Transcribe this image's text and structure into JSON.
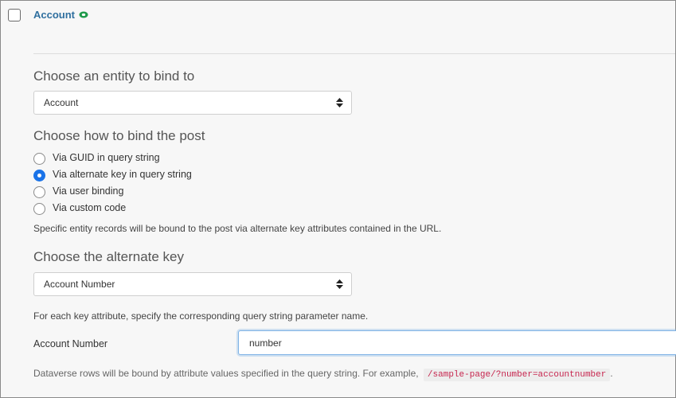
{
  "record": {
    "title": "Account"
  },
  "entity": {
    "heading": "Choose an entity to bind to",
    "selected": "Account"
  },
  "binding": {
    "heading": "Choose how to bind the post",
    "options": [
      {
        "label": "Via GUID in query string",
        "selected": false
      },
      {
        "label": "Via alternate key in query string",
        "selected": true
      },
      {
        "label": "Via user binding",
        "selected": false
      },
      {
        "label": "Via custom code",
        "selected": false
      }
    ],
    "description": "Specific entity records will be bound to the post via alternate key attributes contained in the URL."
  },
  "alternate_key": {
    "heading": "Choose the alternate key",
    "selected": "Account Number",
    "instruction": "For each key attribute, specify the corresponding query string parameter name.",
    "field_label": "Account Number",
    "field_value": "number",
    "example_text": "Dataverse rows will be bound by attribute values specified in the query string. For example,",
    "example_code": "/sample-page/?number=accountnumber",
    "example_suffix": "."
  },
  "colors": {
    "accent": "#1a73e8",
    "title": "#2f6f9f",
    "code": "#c7254e",
    "link_icon": "#1e9a4a"
  }
}
